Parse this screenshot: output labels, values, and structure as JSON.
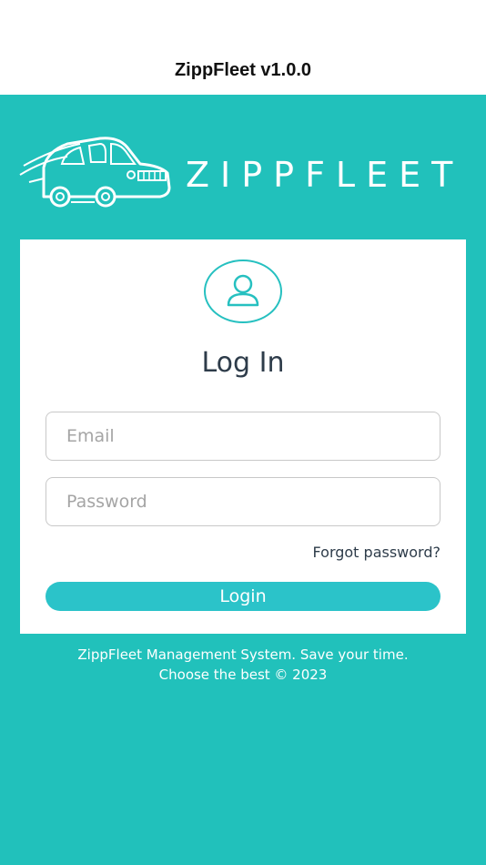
{
  "header": {
    "title": "ZippFleet v1.0.0"
  },
  "brand": {
    "logo_text": "ZIPPFLEET"
  },
  "login": {
    "title": "Log In",
    "email_placeholder": "Email",
    "password_placeholder": "Password",
    "forgot_label": "Forgot password?",
    "button_label": "Login"
  },
  "footer": {
    "line1": "ZippFleet Management System. Save your time.",
    "line2": "Choose the best © 2023"
  },
  "colors": {
    "teal_background": "#21c1bb",
    "button": "#2bc3c9",
    "title_text": "#2e3c4a"
  },
  "icons": {
    "logo": "van-icon",
    "avatar": "user-icon"
  }
}
